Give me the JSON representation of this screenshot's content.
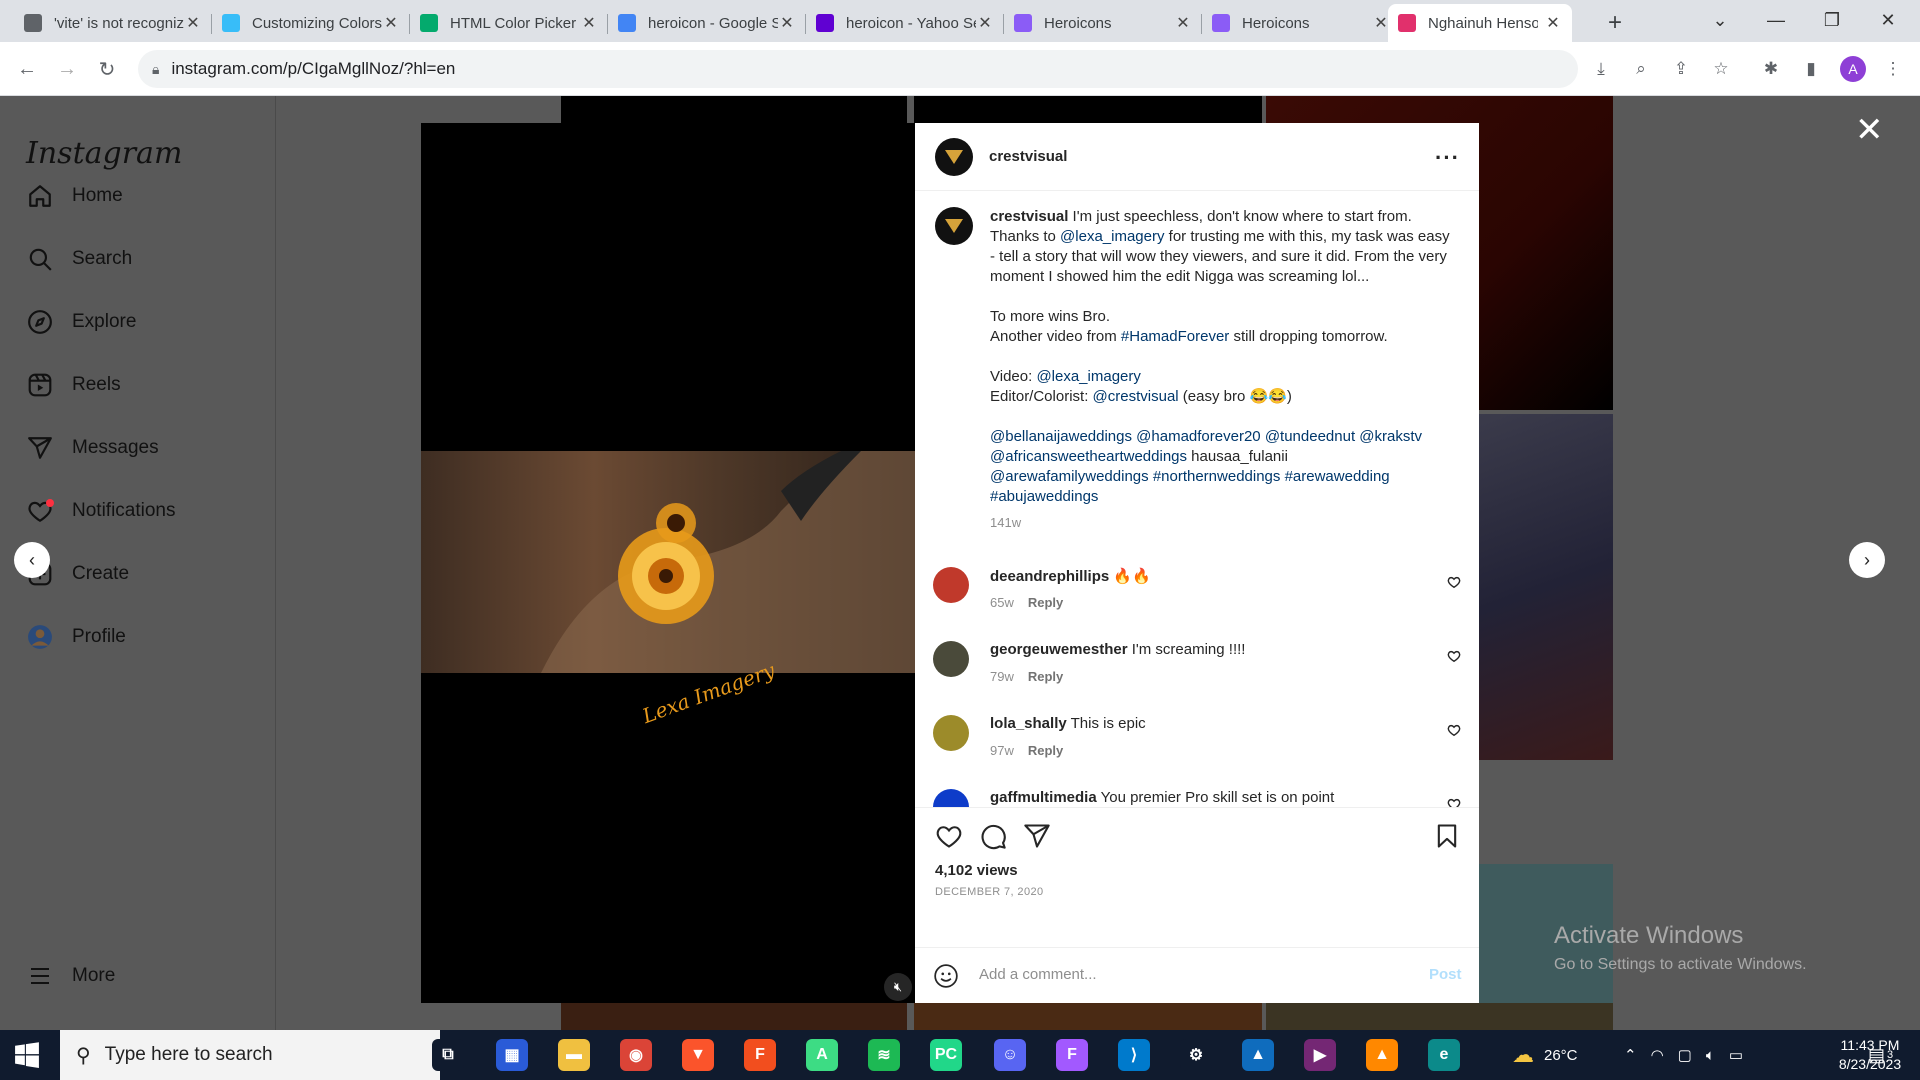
{
  "browser": {
    "tabs": [
      {
        "title": "'vite' is not recognized",
        "favicon": "page-icon",
        "color": "#5f6368"
      },
      {
        "title": "Customizing Colors",
        "favicon": "tailwind-icon",
        "color": "#38bdf8"
      },
      {
        "title": "HTML Color Picker",
        "favicon": "w3schools-icon",
        "color": "#04aa6d"
      },
      {
        "title": "heroicon - Google Search",
        "favicon": "google-icon",
        "color": "#4285f4"
      },
      {
        "title": "heroicon - Yahoo Search",
        "favicon": "yahoo-icon",
        "color": "#6001d2"
      },
      {
        "title": "Heroicons",
        "favicon": "heroicons-icon",
        "color": "#8b5cf6"
      },
      {
        "title": "Heroicons",
        "favicon": "heroicons-icon",
        "color": "#8b5cf6"
      },
      {
        "title": "Nghainuh Henson",
        "favicon": "instagram-icon",
        "color": "#e1306c"
      }
    ],
    "new_tab": "+",
    "url": "instagram.com/p/CIgaMgllNoz/?hl=en",
    "profile_initial": "A"
  },
  "instagram": {
    "logo": "Instagram",
    "nav": [
      {
        "label": "Home",
        "icon": "home-icon"
      },
      {
        "label": "Search",
        "icon": "search-icon"
      },
      {
        "label": "Explore",
        "icon": "compass-icon"
      },
      {
        "label": "Reels",
        "icon": "reels-icon"
      },
      {
        "label": "Messages",
        "icon": "send-icon"
      },
      {
        "label": "Notifications",
        "icon": "heart-icon"
      },
      {
        "label": "Create",
        "icon": "plus-square-icon"
      },
      {
        "label": "Profile",
        "icon": "avatar-icon"
      }
    ],
    "more": "More"
  },
  "post": {
    "username": "crestvisual",
    "caption_lines": [
      [
        {
          "t": "crestvisual",
          "b": true
        },
        {
          "t": " I'm just speechless, don't know where to start from. Thanks to "
        },
        {
          "t": "@lexa_imagery",
          "l": true
        },
        {
          "t": " for trusting me with this, my task was easy - tell a story that will wow they viewers, and sure it did. From the very moment I showed him the edit Nigga was screaming lol..."
        }
      ],
      [],
      [
        {
          "t": "To more wins Bro."
        }
      ],
      [
        {
          "t": "Another video from "
        },
        {
          "t": "#HamadForever",
          "l": true
        },
        {
          "t": " still dropping tomorrow."
        }
      ],
      [],
      [
        {
          "t": "Video: "
        },
        {
          "t": "@lexa_imagery",
          "l": true
        }
      ],
      [
        {
          "t": "Editor/Colorist: "
        },
        {
          "t": "@crestvisual",
          "l": true
        },
        {
          "t": " (easy bro 😂😂)"
        }
      ],
      [],
      [
        {
          "t": "@bellanaijaweddings",
          "l": true
        },
        {
          "t": " "
        },
        {
          "t": "@hamadforever20",
          "l": true
        },
        {
          "t": " "
        },
        {
          "t": "@tundeednut",
          "l": true
        },
        {
          "t": " "
        },
        {
          "t": "@krakstv",
          "l": true
        },
        {
          "t": " "
        },
        {
          "t": "@africansweetheartweddings",
          "l": true
        },
        {
          "t": " hausaa_fulanii "
        },
        {
          "t": "@arewafamilyweddings",
          "l": true
        },
        {
          "t": " "
        },
        {
          "t": "#northernweddings",
          "l": true
        },
        {
          "t": " "
        },
        {
          "t": "#arewawedding",
          "l": true
        },
        {
          "t": " "
        },
        {
          "t": "#abujaweddings",
          "l": true
        }
      ]
    ],
    "caption_age": "141w",
    "comments": [
      {
        "user": "deeandrephillips",
        "text": "🔥🔥",
        "age": "65w",
        "reply": "Reply",
        "avatar_color": "#c0392b"
      },
      {
        "user": "georgeuwemesther",
        "text": "I'm screaming !!!!",
        "age": "79w",
        "reply": "Reply",
        "avatar_color": "#4a4a3a"
      },
      {
        "user": "lola_shally",
        "text": "This is epic",
        "age": "97w",
        "reply": "Reply",
        "avatar_color": "#9c8b2a"
      },
      {
        "user": "gaffmultimedia",
        "text": "You premier Pro skill set is on point",
        "age": "",
        "reply": "",
        "avatar_color": "#0e3cc9"
      }
    ],
    "views": "4,102 views",
    "date": "DECEMBER 7, 2020",
    "add_comment_placeholder": "Add a comment...",
    "post_button": "Post",
    "watermark_text": "Lexa Imagery"
  },
  "windows_watermark": {
    "title": "Activate Windows",
    "subtitle": "Go to Settings to activate Windows."
  },
  "taskbar": {
    "search_placeholder": "Type here to search",
    "weather": "26°C",
    "time": "11:43 PM",
    "date": "8/23/2023",
    "notification_count": "3",
    "apps": [
      {
        "name": "task-view-icon",
        "color": "#101b2e",
        "label": "⧉"
      },
      {
        "name": "store-icon",
        "color": "#2a5bd7",
        "label": "▦"
      },
      {
        "name": "file-explorer-icon",
        "color": "#f0c040",
        "label": "▬"
      },
      {
        "name": "chrome-icon",
        "color": "#db4437",
        "label": "◉"
      },
      {
        "name": "brave-icon",
        "color": "#fb542b",
        "label": "▼"
      },
      {
        "name": "figma-icon",
        "color": "#f24e1e",
        "label": "F"
      },
      {
        "name": "android-studio-icon",
        "color": "#3ddc84",
        "label": "A"
      },
      {
        "name": "spotify-icon",
        "color": "#1db954",
        "label": "≋"
      },
      {
        "name": "pycharm-icon",
        "color": "#21d789",
        "label": "PC"
      },
      {
        "name": "discord-icon",
        "color": "#5865f2",
        "label": "☺"
      },
      {
        "name": "figma-icon",
        "color": "#a259ff",
        "label": "F"
      },
      {
        "name": "vscode-icon",
        "color": "#007acc",
        "label": "⟩"
      },
      {
        "name": "settings-icon",
        "color": "#101b2e",
        "label": "⚙"
      },
      {
        "name": "photos-icon",
        "color": "#0f6cbd",
        "label": "▲"
      },
      {
        "name": "powerapps-icon",
        "color": "#742774",
        "label": "▶"
      },
      {
        "name": "vlc-icon",
        "color": "#ff8800",
        "label": "▲"
      },
      {
        "name": "edge-icon",
        "color": "#0c8a8a",
        "label": "e"
      }
    ]
  }
}
